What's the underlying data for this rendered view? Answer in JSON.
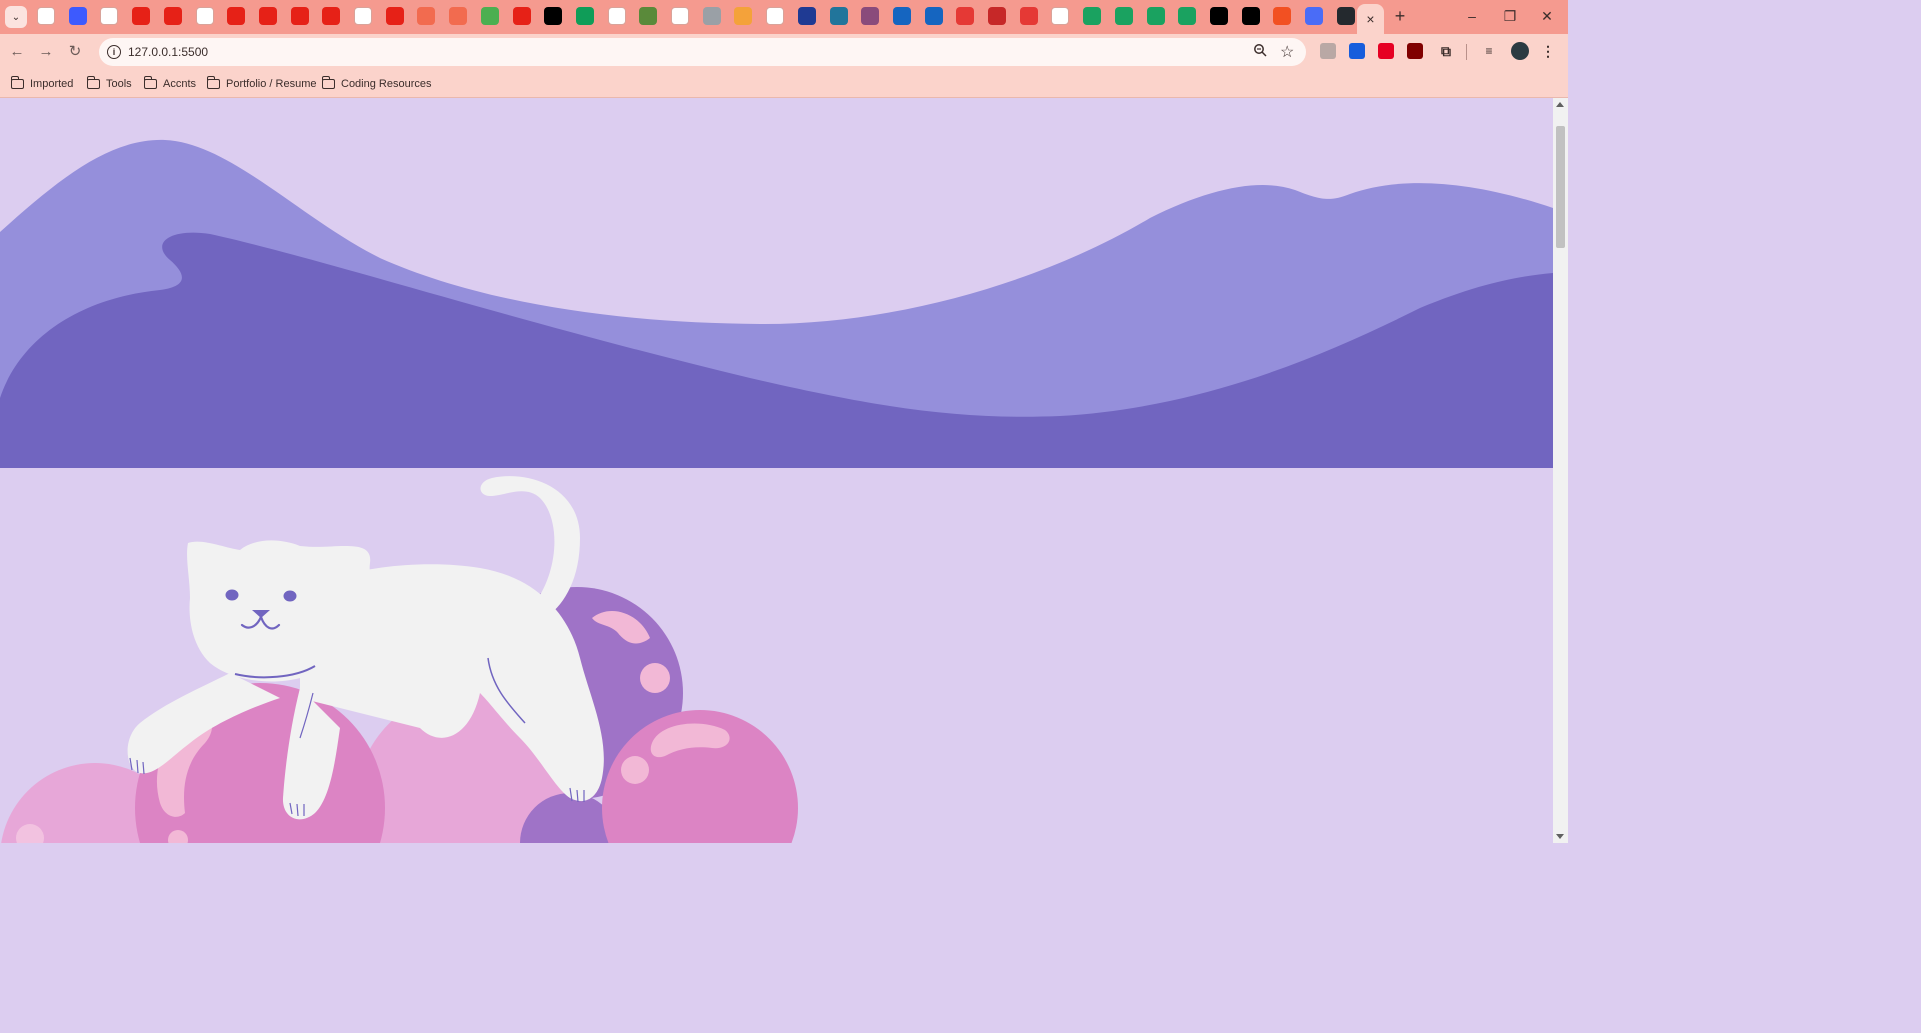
{
  "browser": {
    "url": "127.0.0.1:5500",
    "active_tab_close": "×",
    "new_tab": "+",
    "window_controls": {
      "minimize": "–",
      "restore": "❐",
      "close": "✕"
    },
    "tab_favicons": [
      {
        "icon": "mail-icon",
        "color": "#ffffff"
      },
      {
        "icon": "chatbot-icon",
        "color": "#3d5afe"
      },
      {
        "icon": "google-icon",
        "color": "#ffffff"
      },
      {
        "icon": "youtube-icon",
        "color": "#e62117"
      },
      {
        "icon": "youtube-icon",
        "color": "#e62117"
      },
      {
        "icon": "openai-icon",
        "color": "#ffffff"
      },
      {
        "icon": "youtube-icon",
        "color": "#e62117"
      },
      {
        "icon": "youtube-icon",
        "color": "#e62117"
      },
      {
        "icon": "youtube-icon",
        "color": "#e62117"
      },
      {
        "icon": "youtube-icon",
        "color": "#e62117"
      },
      {
        "icon": "mask-icon",
        "color": "#ffffff"
      },
      {
        "icon": "youtube-icon",
        "color": "#e62117"
      },
      {
        "icon": "sparkle-icon",
        "color": "#f26b4f"
      },
      {
        "icon": "sparkle-icon",
        "color": "#f26b4f"
      },
      {
        "icon": "colorful-icon",
        "color": "#4caf50"
      },
      {
        "icon": "youtube-icon",
        "color": "#e62117"
      },
      {
        "icon": "medium-icon",
        "color": "#000000"
      },
      {
        "icon": "sheets-icon",
        "color": "#0f9d58"
      },
      {
        "icon": "google-icon",
        "color": "#ffffff"
      },
      {
        "icon": "leaf-icon",
        "color": "#5a8a3a"
      },
      {
        "icon": "c-icon",
        "color": "#ffffff"
      },
      {
        "icon": "box-icon",
        "color": "#9aa0a6"
      },
      {
        "icon": "feather-icon",
        "color": "#f4a23a"
      },
      {
        "icon": "openai-icon",
        "color": "#ffffff"
      },
      {
        "icon": "circle-icon",
        "color": "#1f3a93"
      },
      {
        "icon": "wordpress-icon",
        "color": "#21759b"
      },
      {
        "icon": "shield-icon",
        "color": "#8a4b7b"
      },
      {
        "icon": "mdp-icon",
        "color": "#1565c0"
      },
      {
        "icon": "mdp-icon",
        "color": "#1565c0"
      },
      {
        "icon": "c-red-icon",
        "color": "#e53935"
      },
      {
        "icon": "rh-icon",
        "color": "#c62828"
      },
      {
        "icon": "c-red-icon",
        "color": "#e53935"
      },
      {
        "icon": "info-icon",
        "color": "#ffffff"
      },
      {
        "icon": "green-icon",
        "color": "#1aa260"
      },
      {
        "icon": "green-icon",
        "color": "#1aa260"
      },
      {
        "icon": "green-icon",
        "color": "#1aa260"
      },
      {
        "icon": "green-icon",
        "color": "#1aa260"
      },
      {
        "icon": "qt-icon",
        "color": "#000000"
      },
      {
        "icon": "qt-icon",
        "color": "#000000"
      },
      {
        "icon": "microsoft-icon",
        "color": "#f25022"
      },
      {
        "icon": "chat-icon",
        "color": "#4a6cf7"
      },
      {
        "icon": "github-icon",
        "color": "#24292e"
      }
    ],
    "bookmarks": [
      "Imported",
      "Tools",
      "Accnts",
      "Portfolio / Resume",
      "Coding Resources"
    ],
    "extensions": [
      {
        "icon": "puzzle-grey-icon",
        "color": "#b9a8a5"
      },
      {
        "icon": "bitwarden-icon",
        "color": "#175ddc"
      },
      {
        "icon": "pinterest-icon",
        "color": "#e60023"
      },
      {
        "icon": "ublock-icon",
        "color": "#800000"
      }
    ]
  },
  "colors": {
    "chrome_tabstrip": "#f59a8f",
    "chrome_toolbar": "#fbd3cb",
    "page_bg": "#dccdf0",
    "wave_light": "#958fdb",
    "wave_dark": "#7165c0",
    "cat": "#f2f2f2",
    "ball_pink": "#dc84c4",
    "ball_light_pink": "#e7a7d8",
    "ball_purple": "#9f73c7"
  }
}
